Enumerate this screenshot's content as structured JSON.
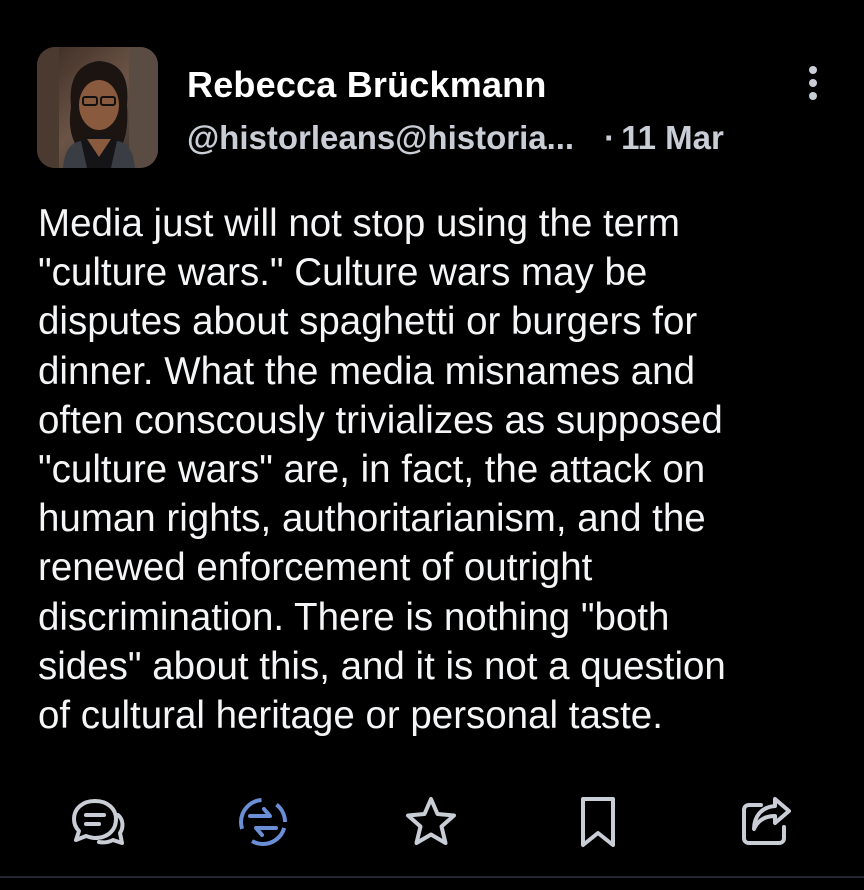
{
  "author": {
    "display_name": "Rebecca Brückmann",
    "handle": "@historleans@historia...",
    "separator": "·",
    "timestamp": "11 Mar"
  },
  "content": {
    "lines": [
      "Media just will not stop using the term",
      "\"culture wars.\" Culture wars may be",
      "disputes about spaghetti or burgers for",
      "dinner. What the media misnames and",
      "often conscously trivializes as supposed",
      "\"culture wars\" are, in fact, the attack on",
      "human rights, authoritarianism, and the",
      "renewed enforcement of outright",
      "discrimination. There is nothing \"both",
      "sides\" about this, and it is not a question",
      "of cultural heritage or personal taste."
    ]
  },
  "actions": [
    {
      "icon": "reply-icon",
      "color": "#c9cdd6"
    },
    {
      "icon": "boost-icon",
      "color": "#6b8fd6"
    },
    {
      "icon": "star-icon",
      "color": "#c9cdd6"
    },
    {
      "icon": "bookmark-icon",
      "color": "#c9cdd6"
    },
    {
      "icon": "share-icon",
      "color": "#c9cdd6"
    }
  ],
  "colors": {
    "background": "#000000",
    "text": "#f4f5f7",
    "muted": "#c9cdd6",
    "boost_active": "#6b8fd6"
  }
}
